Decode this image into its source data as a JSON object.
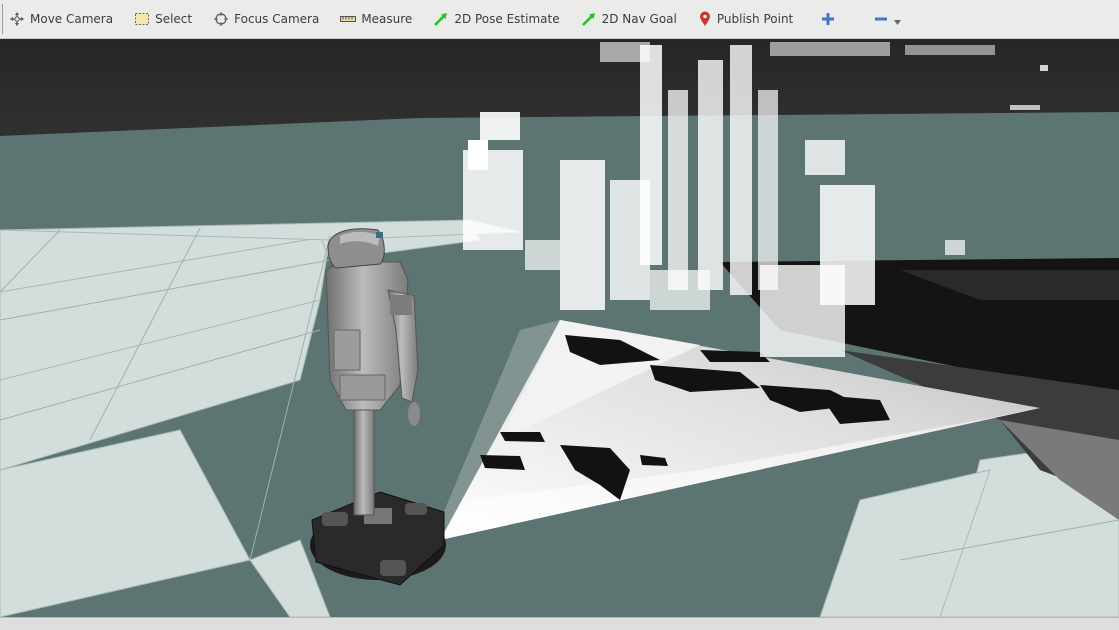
{
  "toolbar": {
    "tools": [
      {
        "label": "Move Camera",
        "icon": "move-camera-icon"
      },
      {
        "label": "Select",
        "icon": "select-icon"
      },
      {
        "label": "Focus Camera",
        "icon": "focus-camera-icon"
      },
      {
        "label": "Measure",
        "icon": "measure-icon"
      },
      {
        "label": "2D Pose Estimate",
        "icon": "pose-arrow-icon"
      },
      {
        "label": "2D Nav Goal",
        "icon": "nav-goal-arrow-icon"
      },
      {
        "label": "Publish Point",
        "icon": "map-pin-icon"
      }
    ],
    "add_tool_icon": "plus-icon",
    "remove_tool_icon": "minus-icon",
    "dropdown_icon": "chevron-down-icon"
  },
  "colors": {
    "toolbar_bg": "#ebebea",
    "sky": "#2b2b2b",
    "floor": "#5f7673",
    "grid_tile": "#d2dcdb",
    "pose_arrow_green": "#22c222",
    "pin_red": "#c0392b",
    "plus_blue": "#3a78c8"
  }
}
